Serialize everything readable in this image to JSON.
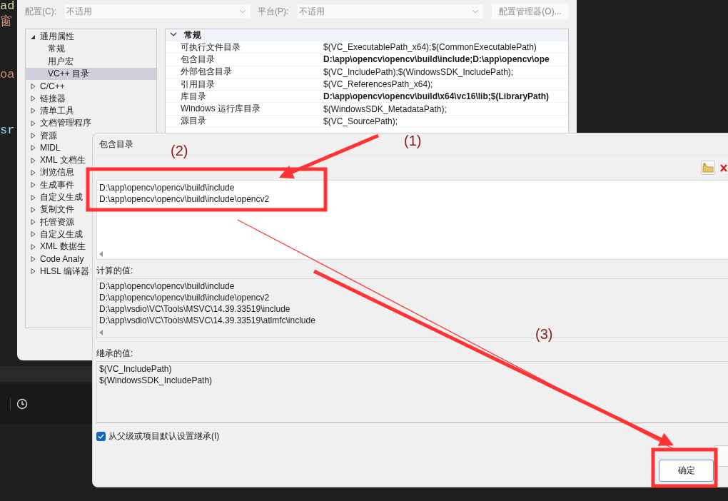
{
  "editor": {
    "fragments": [
      {
        "text": "ad",
        "color": "#dcdcaa"
      },
      {
        "text": "窗",
        "color": "#ce9178"
      },
      {
        "text": "oa",
        "color": "#ce9178"
      },
      {
        "text": "sr",
        "color": "#9cdcfe"
      }
    ]
  },
  "property_pages": {
    "config_label": "配置(C):",
    "config_value": "不适用",
    "platform_label": "平台(P):",
    "platform_value": "不适用",
    "config_manager_button": "配置管理器(O)...",
    "tree": [
      {
        "label": "通用属性",
        "expanded": true,
        "selected": false,
        "children": [
          {
            "label": "常规",
            "selected": false
          },
          {
            "label": "用户宏",
            "selected": false
          },
          {
            "label": "VC++ 目录",
            "selected": true
          }
        ]
      },
      {
        "label": "C/C++",
        "expanded": false,
        "selected": false
      },
      {
        "label": "链接器",
        "expanded": false,
        "selected": false
      },
      {
        "label": "清单工具",
        "expanded": false,
        "selected": false
      },
      {
        "label": "文档管理程序",
        "expanded": false,
        "selected": false
      },
      {
        "label": "资源",
        "expanded": false,
        "selected": false
      },
      {
        "label": "MIDL",
        "expanded": false,
        "selected": false
      },
      {
        "label": "XML 文档生",
        "expanded": false,
        "selected": false
      },
      {
        "label": "浏览信息",
        "expanded": false,
        "selected": false
      },
      {
        "label": "生成事件",
        "expanded": false,
        "selected": false
      },
      {
        "label": "自定义生成",
        "expanded": false,
        "selected": false
      },
      {
        "label": "复制文件",
        "expanded": false,
        "selected": false
      },
      {
        "label": "托管资源",
        "expanded": false,
        "selected": false
      },
      {
        "label": "自定义生成",
        "expanded": false,
        "selected": false
      },
      {
        "label": "XML 数据生",
        "expanded": false,
        "selected": false
      },
      {
        "label": "Code Analy",
        "expanded": false,
        "selected": false
      },
      {
        "label": "HLSL 编译器",
        "expanded": false,
        "selected": false
      }
    ],
    "grid": {
      "section": "常规",
      "expanded": true,
      "rows": [
        {
          "name": "可执行文件目录",
          "value": "$(VC_ExecutablePath_x64);$(CommonExecutablePath)",
          "modified": false
        },
        {
          "name": "包含目录",
          "value": "D:\\app\\opencv\\opencv\\build\\include;D:\\app\\opencv\\ope",
          "modified": true
        },
        {
          "name": "外部包含目录",
          "value": "$(VC_IncludePath);$(WindowsSDK_IncludePath);",
          "modified": false
        },
        {
          "name": "引用目录",
          "value": "$(VC_ReferencesPath_x64);",
          "modified": false
        },
        {
          "name": "库目录",
          "value": "D:\\app\\opencv\\opencv\\build\\x64\\vc16\\lib;$(LibraryPath)",
          "modified": true
        },
        {
          "name": "Windows 运行库目录",
          "value": "$(WindowsSDK_MetadataPath);",
          "modified": false
        },
        {
          "name": "源目录",
          "value": "$(VC_SourcePath);",
          "modified": false
        }
      ]
    }
  },
  "dialog": {
    "title": "包含目录",
    "entries": [
      "D:\\app\\opencv\\opencv\\build\\include",
      "D:\\app\\opencv\\opencv\\build\\include\\opencv2"
    ],
    "computed_label": "计算的值:",
    "computed_values": [
      "D:\\app\\opencv\\opencv\\build\\include",
      "D:\\app\\opencv\\opencv\\build\\include\\opencv2",
      "D:\\app\\vsdio\\VC\\Tools\\MSVC\\14.39.33519\\include",
      "D:\\app\\vsdio\\VC\\Tools\\MSVC\\14.39.33519\\atlmfc\\include"
    ],
    "inherited_label": "继承的值:",
    "inherited_values": [
      "$(VC_IncludePath)",
      "$(WindowsSDK_IncludePath)"
    ],
    "inherit_checkbox": {
      "label": "从父级或项目默认设置继承(I)",
      "checked": true
    },
    "ok_button": "确定"
  },
  "annotations": [
    {
      "text": "(1)"
    },
    {
      "text": "(2)"
    },
    {
      "text": "(3)"
    }
  ]
}
